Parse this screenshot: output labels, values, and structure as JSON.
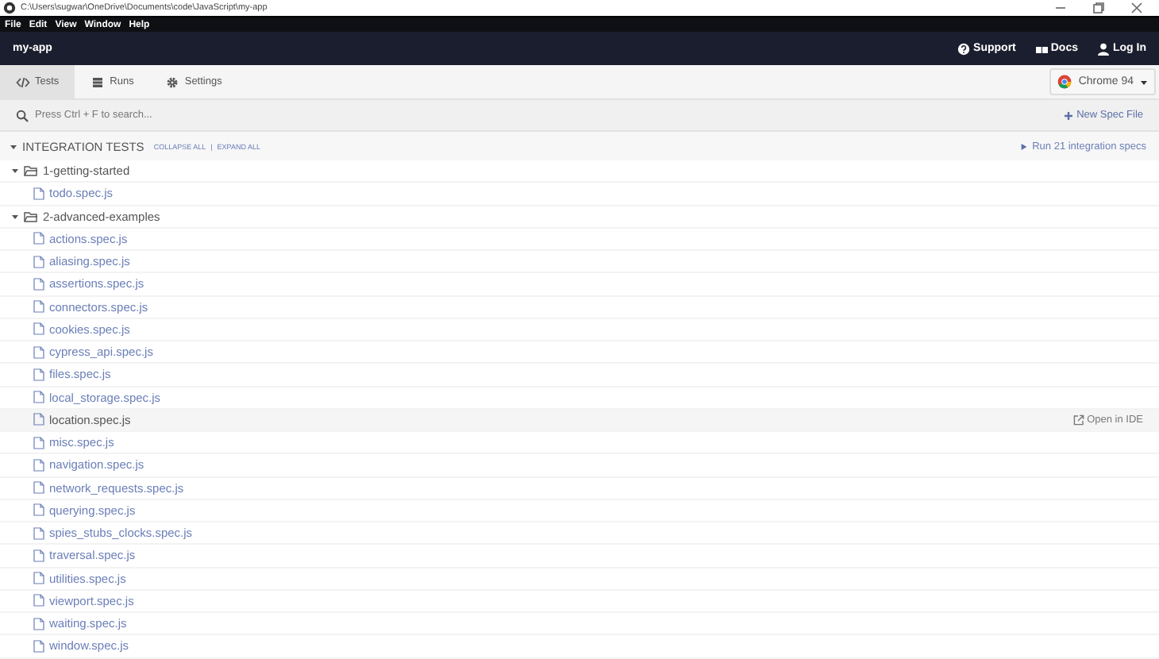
{
  "window": {
    "title": "C:\\Users\\sugwar\\OneDrive\\Documents\\code\\JavaScript\\my-app"
  },
  "menu": [
    "File",
    "Edit",
    "View",
    "Window",
    "Help"
  ],
  "header": {
    "app_name": "my-app",
    "links": [
      {
        "kind": "support",
        "label": "Support"
      },
      {
        "kind": "docs",
        "label": "Docs"
      },
      {
        "kind": "login",
        "label": "Log In"
      }
    ]
  },
  "tabs": [
    {
      "kind": "code",
      "label": "Tests",
      "selected": true
    },
    {
      "kind": "runs",
      "label": "Runs",
      "selected": false
    },
    {
      "kind": "gear",
      "label": "Settings",
      "selected": false
    }
  ],
  "browser": {
    "label": "Chrome 94"
  },
  "search": {
    "placeholder": "Press Ctrl + F to search..."
  },
  "new_spec": "New Spec File",
  "section": {
    "title": "INTEGRATION TESTS",
    "expanded": true,
    "collapse_all": "COLLAPSE ALL",
    "separator": "|",
    "expand_all": "EXPAND ALL",
    "run": "Run 21 integration specs"
  },
  "tree": [
    {
      "kind": "folder",
      "name": "1-getting-started",
      "expanded": true,
      "children": [
        {
          "kind": "file",
          "name": "todo.spec.js",
          "hovered": false
        }
      ]
    },
    {
      "kind": "folder",
      "name": "2-advanced-examples",
      "expanded": true,
      "children": [
        {
          "kind": "file",
          "name": "actions.spec.js",
          "hovered": false
        },
        {
          "kind": "file",
          "name": "aliasing.spec.js",
          "hovered": false
        },
        {
          "kind": "file",
          "name": "assertions.spec.js",
          "hovered": false
        },
        {
          "kind": "file",
          "name": "connectors.spec.js",
          "hovered": false
        },
        {
          "kind": "file",
          "name": "cookies.spec.js",
          "hovered": false
        },
        {
          "kind": "file",
          "name": "cypress_api.spec.js",
          "hovered": false
        },
        {
          "kind": "file",
          "name": "files.spec.js",
          "hovered": false
        },
        {
          "kind": "file",
          "name": "local_storage.spec.js",
          "hovered": false
        },
        {
          "kind": "file",
          "name": "location.spec.js",
          "hovered": true,
          "action": "Open in IDE"
        },
        {
          "kind": "file",
          "name": "misc.spec.js",
          "hovered": false
        },
        {
          "kind": "file",
          "name": "navigation.spec.js",
          "hovered": false
        },
        {
          "kind": "file",
          "name": "network_requests.spec.js",
          "hovered": false
        },
        {
          "kind": "file",
          "name": "querying.spec.js",
          "hovered": false
        },
        {
          "kind": "file",
          "name": "spies_stubs_clocks.spec.js",
          "hovered": false
        },
        {
          "kind": "file",
          "name": "traversal.spec.js",
          "hovered": false
        },
        {
          "kind": "file",
          "name": "utilities.spec.js",
          "hovered": false
        },
        {
          "kind": "file",
          "name": "viewport.spec.js",
          "hovered": false
        },
        {
          "kind": "file",
          "name": "waiting.spec.js",
          "hovered": false
        },
        {
          "kind": "file",
          "name": "window.spec.js",
          "hovered": false
        }
      ]
    }
  ]
}
